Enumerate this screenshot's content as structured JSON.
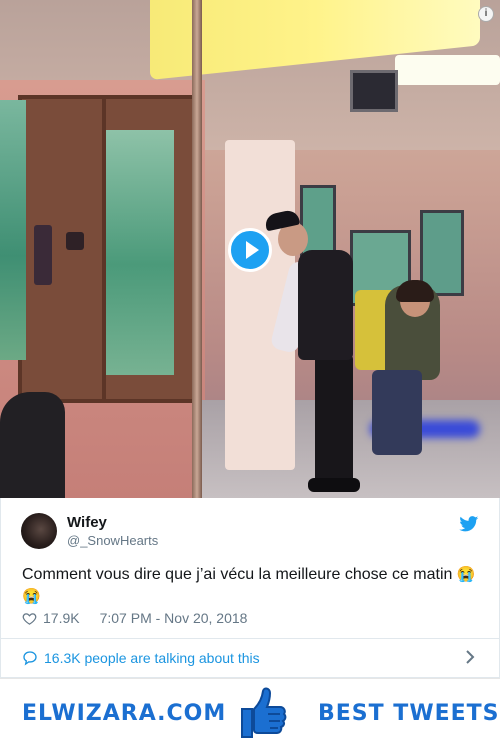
{
  "video": {
    "play_label": "Play video",
    "info_label": "i"
  },
  "tweet": {
    "author_name": "Wifey",
    "author_handle": "@_SnowHearts",
    "text": "Comment vous dire que j’ai vécu la meilleure chose ce matin ",
    "emoji": "😭😭",
    "likes": "17.9K",
    "timestamp": "7:07 PM - Nov 20, 2018",
    "talking": "16.3K people are talking about this"
  },
  "banner": {
    "site": "ELWIZARA.COM",
    "tagline": "BEST TWEETS"
  },
  "colors": {
    "twitter_blue": "#1da1f2",
    "link_blue": "#1b95e0",
    "brand_blue": "#1b6fd1",
    "muted": "#657786"
  }
}
